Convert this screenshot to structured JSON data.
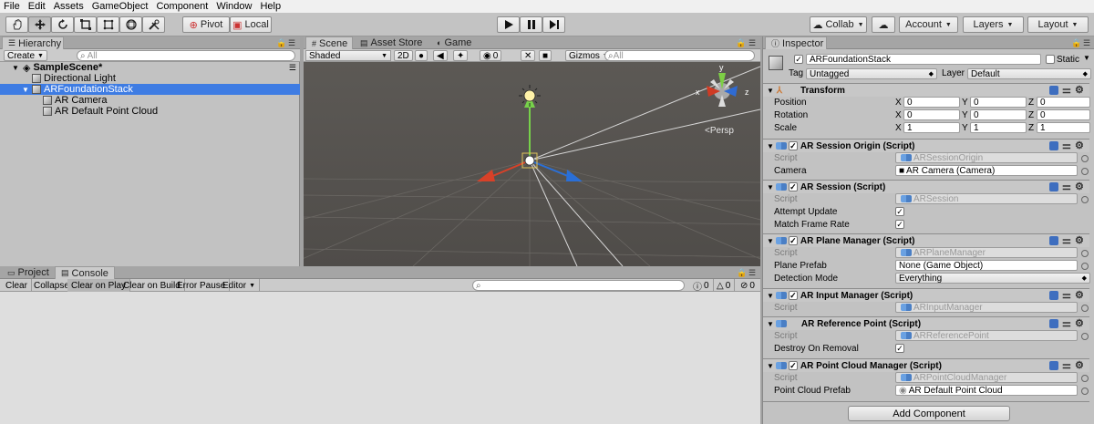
{
  "menu": [
    "File",
    "Edit",
    "Assets",
    "GameObject",
    "Component",
    "Window",
    "Help"
  ],
  "toolbar": {
    "pivot": "Pivot",
    "local": "Local",
    "collab": "Collab",
    "account": "Account",
    "layers": "Layers",
    "layout": "Layout"
  },
  "hierarchy": {
    "tab": "Hierarchy",
    "create": "Create",
    "search_placeholder": "All",
    "items": [
      "SampleScene*",
      "Directional Light",
      "ARFoundationStack",
      "AR Camera",
      "AR Default Point Cloud"
    ]
  },
  "scene": {
    "tabs": [
      "Scene",
      "Asset Store",
      "Game"
    ],
    "shading": "Shaded",
    "mode2d": "2D",
    "fx_count": "0",
    "gizmos": "Gizmos",
    "persp": "<Persp",
    "axes": {
      "x": "x",
      "y": "y",
      "z": "z"
    }
  },
  "bottom": {
    "tabs": [
      "Project",
      "Console"
    ],
    "buttons": [
      "Clear",
      "Collapse",
      "Clear on Play",
      "Clear on Build",
      "Error Pause",
      "Editor"
    ],
    "counts": [
      "0",
      "0",
      "0"
    ]
  },
  "inspector": {
    "tab": "Inspector",
    "object_name": "ARFoundationStack",
    "static_label": "Static",
    "tag_label": "Tag",
    "tag_value": "Untagged",
    "layer_label": "Layer",
    "layer_value": "Default",
    "transform": {
      "title": "Transform",
      "position_label": "Position",
      "rotation_label": "Rotation",
      "scale_label": "Scale",
      "position": [
        "0",
        "0",
        "0"
      ],
      "rotation": [
        "0",
        "0",
        "0"
      ],
      "scale": [
        "1",
        "1",
        "1"
      ]
    },
    "session_origin": {
      "title": "AR Session Origin (Script)",
      "script_label": "Script",
      "script": "ARSessionOrigin",
      "camera_label": "Camera",
      "camera": "AR Camera (Camera)"
    },
    "session": {
      "title": "AR Session (Script)",
      "script_label": "Script",
      "script": "ARSession",
      "attempt_label": "Attempt Update",
      "match_label": "Match Frame Rate"
    },
    "plane_manager": {
      "title": "AR Plane Manager (Script)",
      "script_label": "Script",
      "script": "ARPlaneManager",
      "prefab_label": "Plane Prefab",
      "prefab": "None (Game Object)",
      "detection_label": "Detection Mode",
      "detection": "Everything"
    },
    "input_manager": {
      "title": "AR Input Manager (Script)",
      "script_label": "Script",
      "script": "ARInputManager"
    },
    "reference_point": {
      "title": "AR Reference Point (Script)",
      "script_label": "Script",
      "script": "ARReferencePoint",
      "destroy_label": "Destroy On Removal"
    },
    "point_cloud": {
      "title": "AR Point Cloud Manager (Script)",
      "script_label": "Script",
      "script": "ARPointCloudManager",
      "prefab_label": "Point Cloud Prefab",
      "prefab": "AR Default Point Cloud"
    },
    "add_component": "Add Component"
  }
}
